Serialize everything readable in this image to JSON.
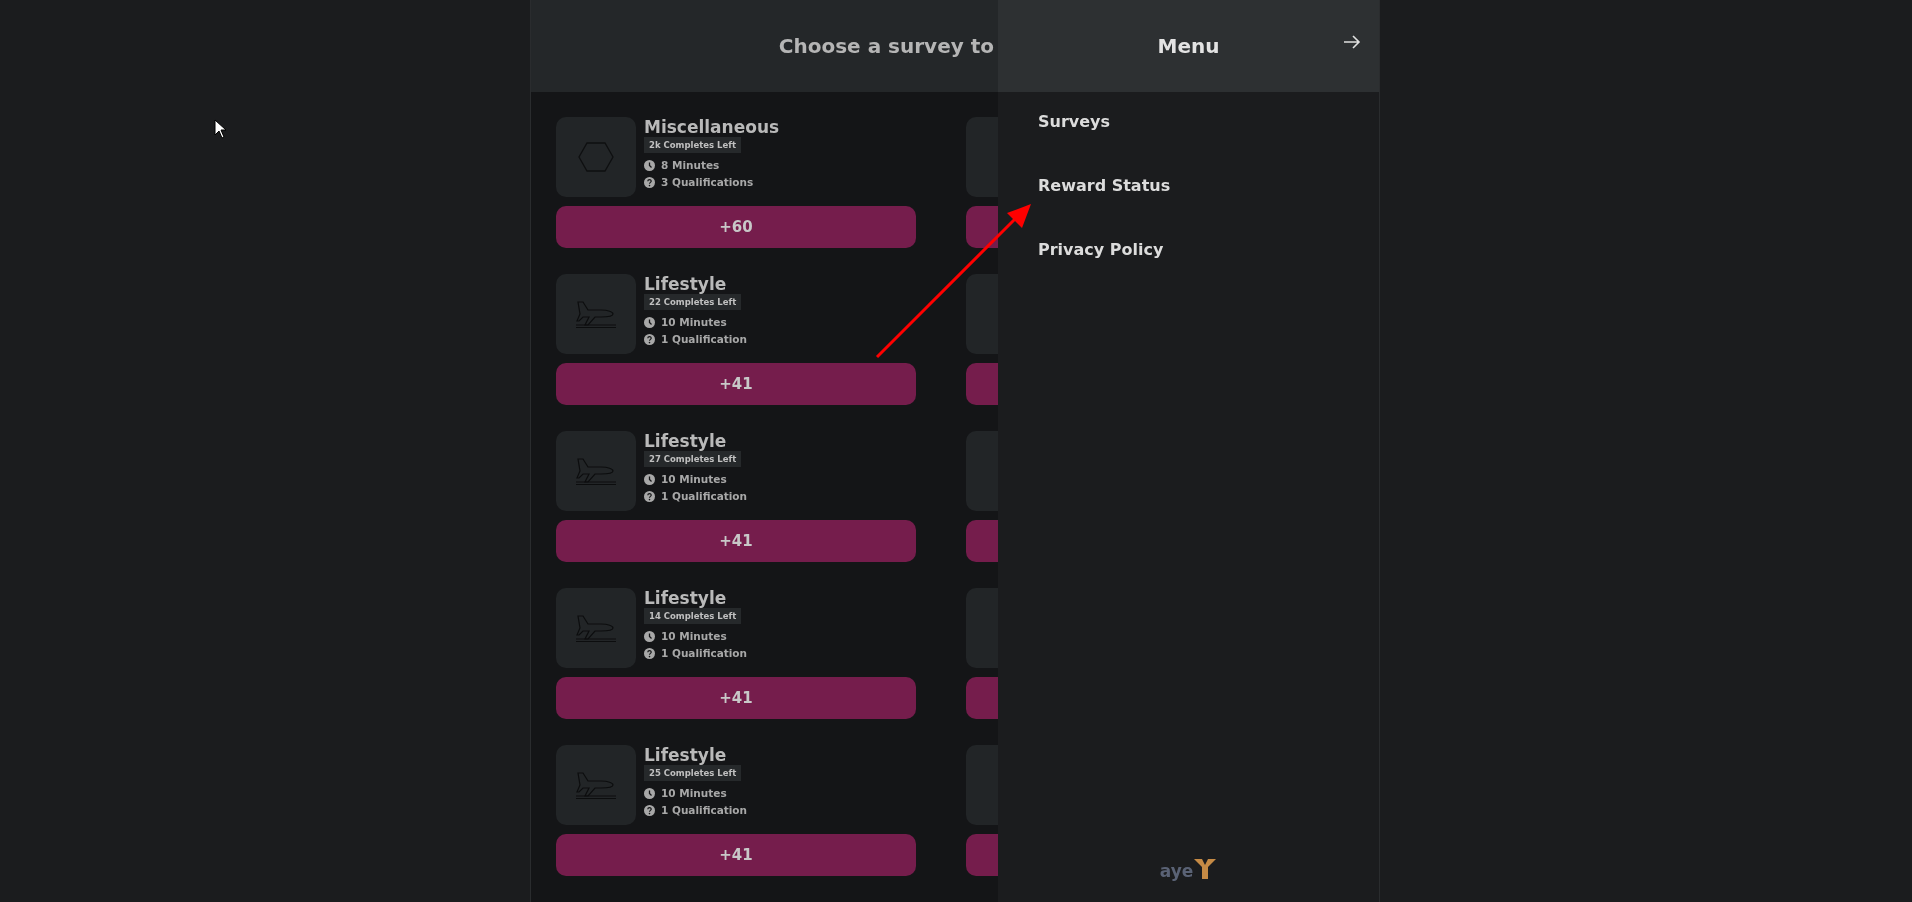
{
  "header": {
    "title": "Choose a survey to"
  },
  "surveys": [
    {
      "category": "Miscellaneous",
      "kind": "hexagon",
      "completes_left": "2k Completes Left",
      "duration": "8 Minutes",
      "qualifications": "3 Qualifications",
      "reward": "+60"
    },
    {
      "category": "Lifestyle",
      "kind": "plane",
      "completes_left": "22 Completes Left",
      "duration": "10 Minutes",
      "qualifications": "1 Qualification",
      "reward": "+41"
    },
    {
      "category": "Lifestyle",
      "kind": "plane",
      "completes_left": "27 Completes Left",
      "duration": "10 Minutes",
      "qualifications": "1 Qualification",
      "reward": "+41"
    },
    {
      "category": "Lifestyle",
      "kind": "plane",
      "completes_left": "14 Completes Left",
      "duration": "10 Minutes",
      "qualifications": "1 Qualification",
      "reward": "+41"
    },
    {
      "category": "Lifestyle",
      "kind": "plane",
      "completes_left": "25 Completes Left",
      "duration": "10 Minutes",
      "qualifications": "1 Qualification",
      "reward": "+41"
    }
  ],
  "menu": {
    "title": "Menu",
    "items": [
      {
        "label": "Surveys"
      },
      {
        "label": "Reward Status"
      },
      {
        "label": "Privacy Policy"
      }
    ]
  },
  "logo": {
    "text": "aye"
  }
}
